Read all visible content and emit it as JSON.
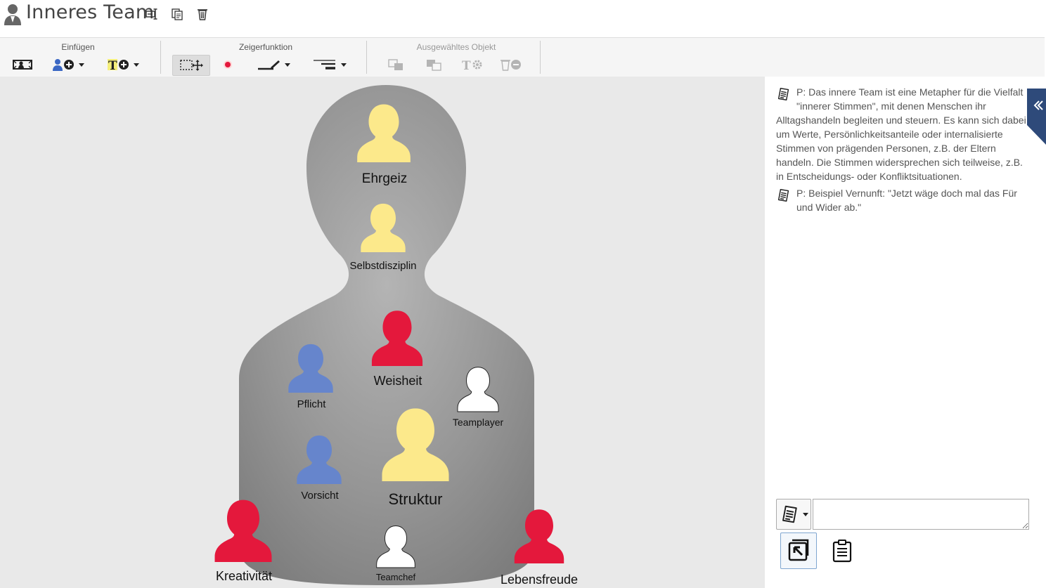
{
  "app": {
    "title": "Inneres Team",
    "title_icon": "person-group-icon",
    "actions": [
      "rename-icon",
      "copy-icon",
      "trash-icon"
    ]
  },
  "toolbar": {
    "groups": [
      {
        "label": "Einfügen",
        "tools": [
          "insert-background-icon",
          "add-person-icon",
          "add-text-icon"
        ]
      },
      {
        "label": "Zeigerfunktion",
        "tools": [
          "select-move-icon",
          "record-dot-icon",
          "pen-icon",
          "line-style-icon"
        ]
      },
      {
        "label": "Ausgewähltes Objekt",
        "disabled": true,
        "tools": [
          "bring-front-icon",
          "send-back-icon",
          "text-settings-icon",
          "delete-object-icon"
        ]
      }
    ],
    "active_tool": "select-move-icon"
  },
  "canvas": {
    "background_figure": "head-and-shoulders-silhouette",
    "figures": [
      {
        "id": "ehrgeiz",
        "label": "Ehrgeiz",
        "color": "#FCE98B"
      },
      {
        "id": "selbstdisziplin",
        "label": "Selbstdisziplin",
        "color": "#FCE98B"
      },
      {
        "id": "weisheit",
        "label": "Weisheit",
        "color": "#E4183C"
      },
      {
        "id": "pflicht",
        "label": "Pflicht",
        "color": "#6685CC"
      },
      {
        "id": "teamplayer",
        "label": "Teamplayer",
        "color": "#FFFFFF"
      },
      {
        "id": "struktur",
        "label": "Struktur",
        "color": "#FCE98B"
      },
      {
        "id": "vorsicht",
        "label": "Vorsicht",
        "color": "#6685CC"
      },
      {
        "id": "kreativitaet",
        "label": "Kreativität",
        "color": "#E4183C"
      },
      {
        "id": "teamchef",
        "label": "Teamchef",
        "color": "#FFFFFF"
      },
      {
        "id": "lebensfreude",
        "label": "Lebensfreude",
        "color": "#E4183C"
      }
    ]
  },
  "notes": [
    {
      "icon": "note-icon",
      "lines": [
        "P: Das innere Team ist eine Metapher für die Vielfalt",
        "\"innerer Stimmen\", mit denen Menschen ihr",
        "Alltagshandeln begleiten und steuern. Es kann sich dabei",
        "um Werte, Persönlichkeitsanteile oder internalisierte",
        "Stimmen von prägenden Personen, z.B. der Eltern",
        "handeln. Die Stimmen widersprechen sich teilweise, z.B.",
        "in Entscheidungs- oder Konfliktsituationen."
      ]
    },
    {
      "icon": "note-icon",
      "lines": [
        "P: Beispiel Vernunft: \"Jetzt wäge doch mal das Für",
        "und Wider ab.\""
      ]
    }
  ],
  "composer": {
    "type_icon": "note-icon",
    "input_value": "",
    "buttons": [
      "save-note-icon",
      "clipboard-icon"
    ]
  },
  "colors": {
    "yellow": "#FCE98B",
    "red": "#E4183C",
    "blue": "#6685CC",
    "white": "#FFFFFF",
    "accent": "#2E4A7A"
  }
}
